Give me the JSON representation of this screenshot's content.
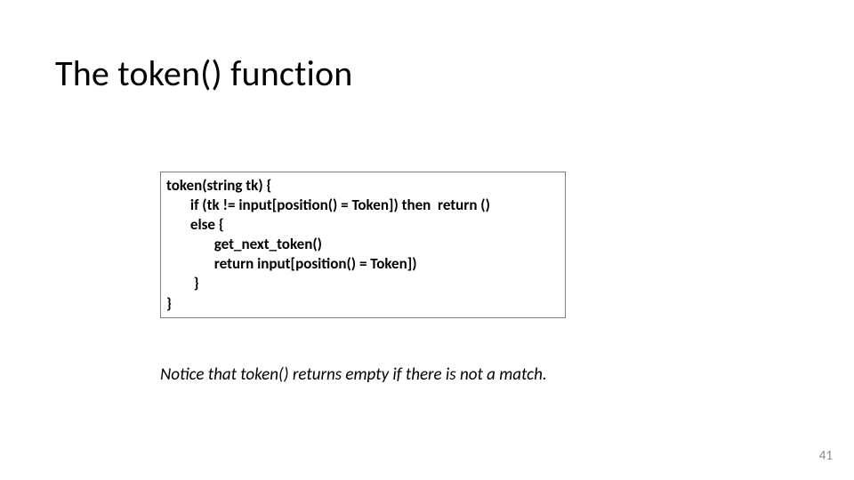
{
  "title": "The token() function",
  "code": "token(string tk) {\n       if (tk != input[position() = Token]) then  return ()\n       else {\n              get_next_token()\n              return input[position() = Token])\n        }\n}",
  "note": "Notice that token() returns empty if there is not a match.",
  "page_number": "41"
}
